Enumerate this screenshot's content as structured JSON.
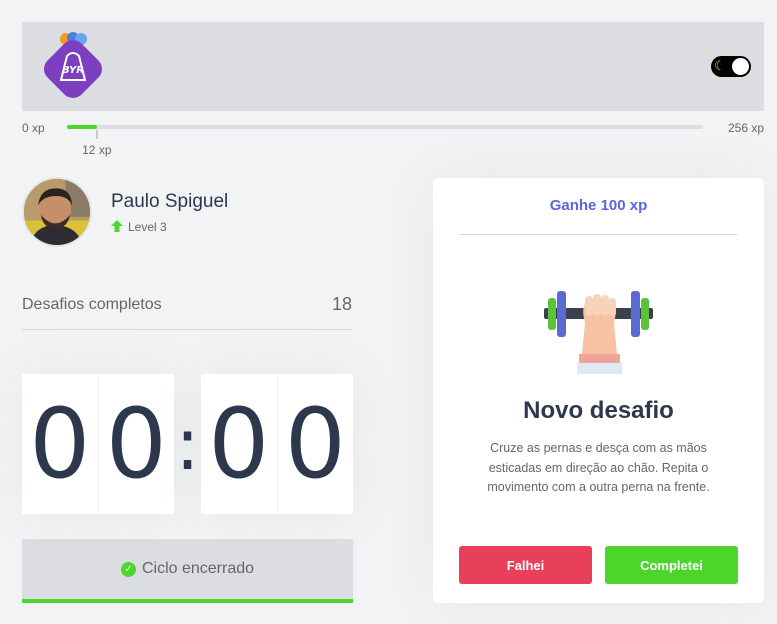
{
  "header": {
    "logo_text": "BYR",
    "theme_toggle": {
      "icon": "moon-icon",
      "state": "dark"
    }
  },
  "experience": {
    "min_label": "0 xp",
    "max_label": "256 xp",
    "current_label": "12 xp",
    "current_xp": 12,
    "max_xp": 256
  },
  "profile": {
    "name": "Paulo Spiguel",
    "level_label": "Level 3"
  },
  "challenges": {
    "label": "Desafios completos",
    "count": "18"
  },
  "countdown": {
    "minute_left": "0",
    "minute_right": "0",
    "separator": ":",
    "second_left": "0",
    "second_right": "0"
  },
  "cycle_button": {
    "label": "Ciclo encerrado"
  },
  "challenge_card": {
    "reward": "Ganhe 100 xp",
    "title": "Novo desafio",
    "description": "Cruze as pernas e desça com as mãos esticadas em direção ao chão. Repita o movimento com a outra perna na frente.",
    "fail_label": "Falhei",
    "complete_label": "Completei",
    "icon": "dumbbell-icon"
  },
  "colors": {
    "accent_blue": "#5965e0",
    "success_green": "#4cd62b",
    "fail_red": "#e83f5b",
    "logo_purple": "#7b3fbf"
  }
}
